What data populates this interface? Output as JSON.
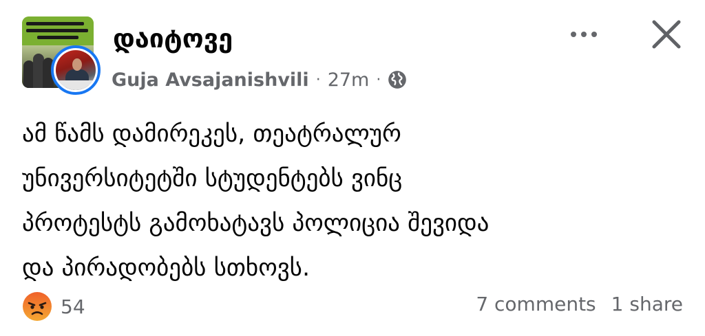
{
  "post": {
    "page_name": "დაიტოვე",
    "author": "Guja Avsajanishvili",
    "separator": "·",
    "time_ago": "27m",
    "audience_icon": "globe-icon",
    "more_icon": "more-dots-icon",
    "close_icon": "close-icon",
    "text_lines": [
      "ამ წამს დამირეკეს, თეატრალურ",
      "უნივერსიტეტში სტუდენტებს ვინც",
      "პროტესტს გამოხატავს პოლიცია შევიდა",
      "და პირადობებს სთხოვს."
    ]
  },
  "footer": {
    "reaction_icon": "angry-reaction-icon",
    "reaction_count": "54",
    "comments": "7 comments",
    "shares": "1 share"
  },
  "colors": {
    "accent_blue": "#1877f2",
    "secondary_text": "#65676b",
    "primary_text": "#050505",
    "angry_orange": "#f0612a"
  }
}
